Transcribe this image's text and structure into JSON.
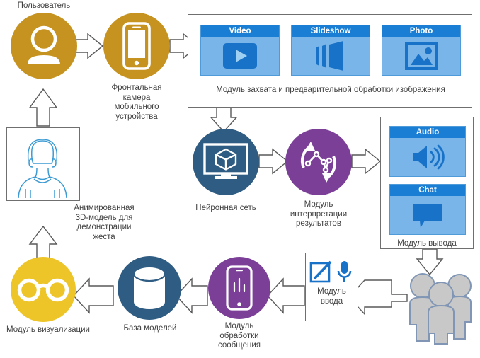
{
  "diagram": {
    "title_hidden": "",
    "colors": {
      "gold": "#c69320",
      "yellow": "#edc528",
      "steel_blue": "#2e5c82",
      "purple": "#7b3f98",
      "tile_header_blue": "#1a7fd4",
      "tile_body_blue": "#79b5e8",
      "icon_blue": "#1872c8",
      "line_gray": "#595959",
      "people_gray": "#c8c8c8",
      "people_outline": "#8096b4",
      "avatar_line": "#3c9bd4",
      "text": "#404040"
    },
    "nodes": {
      "user": {
        "label": "Пользователь",
        "icon": "person-icon",
        "color": "#c69320"
      },
      "front_camera": {
        "label": "Фронтальная\nкамера\nмобильного\nустройства",
        "icon": "smartphone-icon",
        "color": "#c69320"
      },
      "capture_module": {
        "label": "Модуль захвата и предварительной обработки изображения",
        "tiles": [
          {
            "label": "Video",
            "icon": "play-icon"
          },
          {
            "label": "Slideshow",
            "icon": "slides-icon"
          },
          {
            "label": "Photo",
            "icon": "picture-icon"
          }
        ]
      },
      "neural_network": {
        "label": "Нейронная сеть",
        "icon": "monitor-cube-icon",
        "color": "#2e5c82"
      },
      "interpretation_module": {
        "label": "Модуль\nинтерпретации\nрезультатов",
        "icon": "refresh-chart-icon",
        "color": "#7b3f98"
      },
      "output_module": {
        "label": "Модуль вывода",
        "tiles": [
          {
            "label": "Audio",
            "icon": "speaker-icon"
          },
          {
            "label": "Chat",
            "icon": "chat-bubble-icon"
          }
        ]
      },
      "people": {
        "label": "",
        "icon": "people-group-icon"
      },
      "input_module": {
        "label": "Модуль\nввода",
        "icons": [
          "compose-pen-icon",
          "microphone-icon"
        ]
      },
      "message_processing": {
        "label": "Модуль\nобработки\nсообщения",
        "icon": "smartphone-chart-icon",
        "color": "#7b3f98"
      },
      "model_database": {
        "label": "База моделей",
        "icon": "database-cylinder-icon",
        "color": "#2e5c82"
      },
      "visualization_module": {
        "label": "Модуль визуализации",
        "icon": "glasses-icon",
        "color": "#edc528"
      },
      "animated_model": {
        "label": "Анимированная\n3D-модель для\nдемонстрации\nжеста",
        "icon": "avatar-outline-icon"
      }
    },
    "flow": [
      {
        "from": "user",
        "to": "front_camera"
      },
      {
        "from": "front_camera",
        "to": "capture_module"
      },
      {
        "from": "capture_module",
        "to": "neural_network"
      },
      {
        "from": "neural_network",
        "to": "interpretation_module"
      },
      {
        "from": "interpretation_module",
        "to": "output_module"
      },
      {
        "from": "output_module",
        "to": "people"
      },
      {
        "from": "people",
        "to": "input_module"
      },
      {
        "from": "input_module",
        "to": "message_processing"
      },
      {
        "from": "message_processing",
        "to": "model_database"
      },
      {
        "from": "model_database",
        "to": "visualization_module"
      },
      {
        "from": "visualization_module",
        "to": "animated_model"
      },
      {
        "from": "animated_model",
        "to": "user"
      }
    ]
  }
}
